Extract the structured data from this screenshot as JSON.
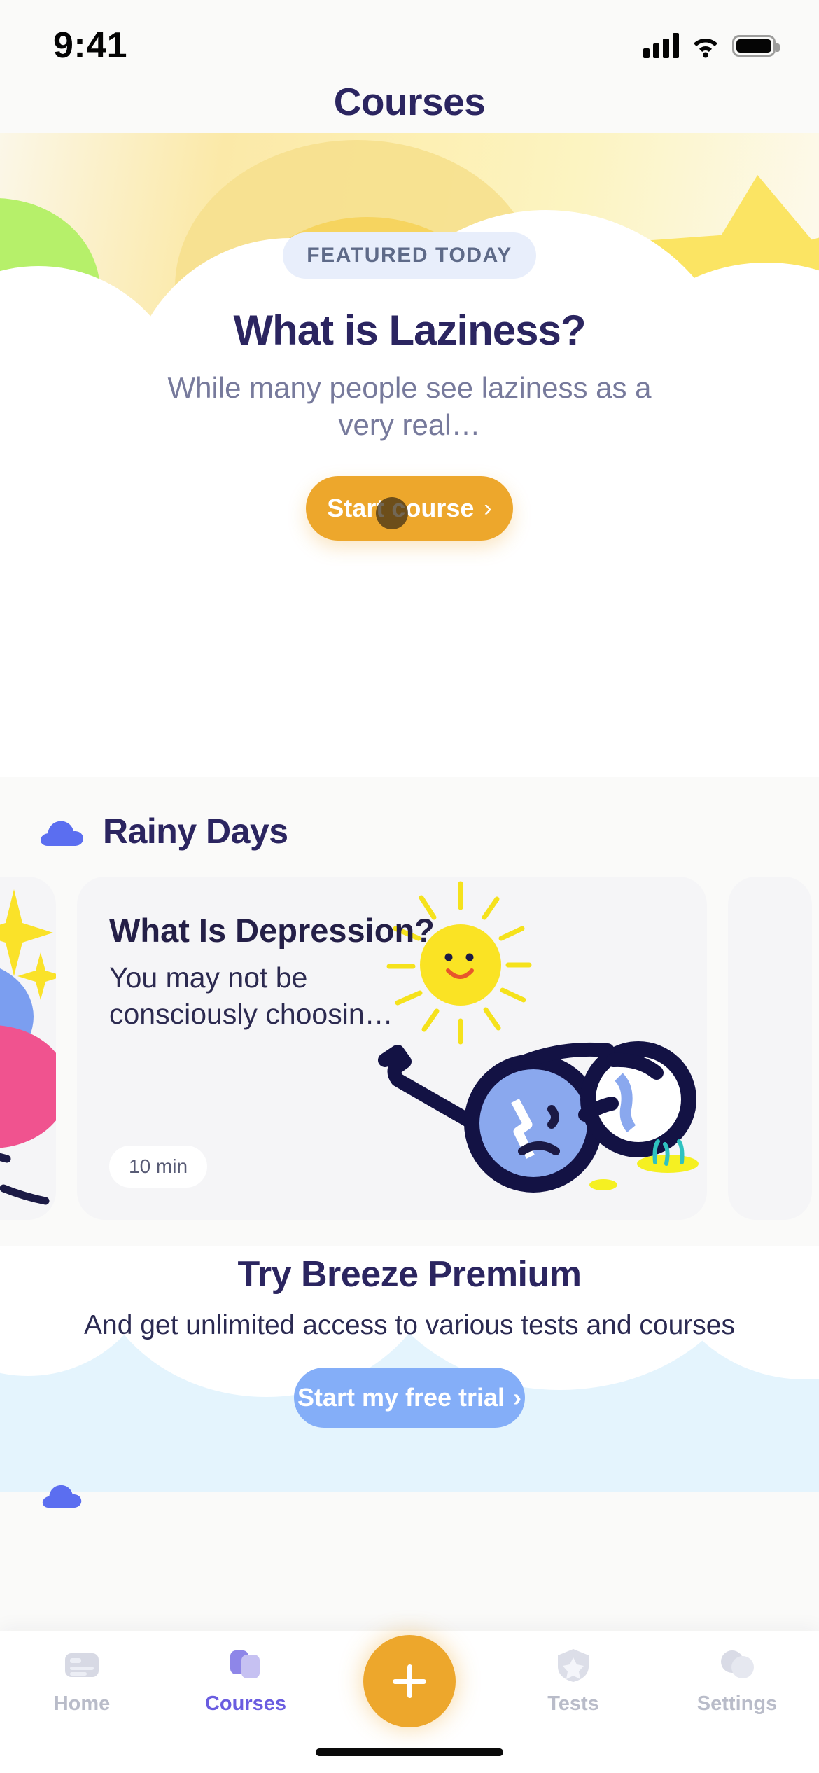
{
  "status_bar": {
    "time": "9:41",
    "signal_icon": "cellular-signal-icon",
    "wifi_icon": "wifi-icon",
    "battery_icon": "battery-full-icon"
  },
  "header": {
    "title": "Courses"
  },
  "hero": {
    "badge": "FEATURED TODAY",
    "title": "What is Laziness?",
    "subtitle": "While many people see laziness as a very real…",
    "button_label": "Start course",
    "button_chevron": "›",
    "button_color": "#eda72c"
  },
  "section": {
    "icon": "cloud-icon",
    "title": "Rainy Days"
  },
  "cards": [
    {
      "title": "What Is Depression?",
      "description": "You may not be consciously choosin…",
      "duration": "10 min",
      "art": "sun-and-glasses-illustration"
    }
  ],
  "premium": {
    "title": "Try Breeze Premium",
    "subtitle": "And get unlimited access to various tests and courses",
    "button_label": "Start my free trial",
    "button_chevron": "›",
    "button_color": "#84aef8"
  },
  "tabbar": {
    "items": [
      {
        "label": "Home",
        "icon": "home-icon",
        "active": false
      },
      {
        "label": "Courses",
        "icon": "courses-icon",
        "active": true
      },
      {
        "label": "Tests",
        "icon": "tests-icon",
        "active": false
      },
      {
        "label": "Settings",
        "icon": "settings-icon",
        "active": false
      }
    ],
    "fab_icon": "plus-icon",
    "active_color": "#6a5de0",
    "inactive_color": "#b9bcc9"
  }
}
